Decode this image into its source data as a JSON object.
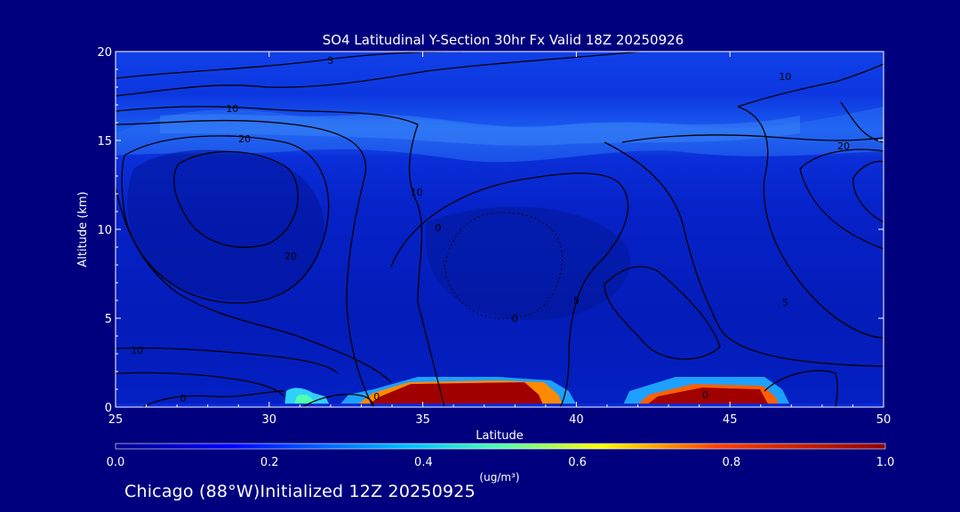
{
  "footer": {
    "location": "Chicago (88°W)",
    "initialized": "Initialized 12Z 20250925"
  },
  "colors": {
    "background": "#00007f",
    "text": "#ffffff",
    "contour": "#000000"
  },
  "chart_data": {
    "type": "heatmap",
    "title": "SO4 Latitudinal Y-Section 30hr  Fx Valid 18Z 20250926",
    "xlabel": "Latitude",
    "ylabel": "Altitude (km)",
    "xlim": [
      25,
      50
    ],
    "ylim": [
      0,
      20
    ],
    "x_ticks": [
      25,
      30,
      35,
      40,
      45,
      50
    ],
    "y_ticks": [
      0,
      5,
      10,
      15,
      20
    ],
    "colorbar": {
      "min": 0.0,
      "max": 1.0,
      "ticks": [
        "0.0",
        "0.2",
        "0.4",
        "0.6",
        "0.8",
        "1.0"
      ],
      "units": "(ug/m³)"
    },
    "concentration_regions": [
      {
        "lat_range": [
          33.5,
          39.5
        ],
        "alt_range": [
          0.0,
          1.4
        ],
        "value": 1.0
      },
      {
        "lat_range": [
          42.0,
          46.5
        ],
        "alt_range": [
          0.0,
          0.9
        ],
        "value": 0.9
      },
      {
        "lat_range": [
          30.5,
          33.0
        ],
        "alt_range": [
          0.0,
          0.8
        ],
        "value": 0.4
      },
      {
        "lat_range": [
          25.0,
          50.0
        ],
        "alt_range": [
          14.0,
          17.5
        ],
        "value": 0.25
      }
    ],
    "contour_labels": [
      {
        "text": "10",
        "lat": 28.8,
        "alt": 16.8
      },
      {
        "text": "20",
        "lat": 29.2,
        "alt": 15.1
      },
      {
        "text": "5",
        "lat": 32.0,
        "alt": 19.5
      },
      {
        "text": "10",
        "lat": 34.8,
        "alt": 12.1
      },
      {
        "text": "20",
        "lat": 30.7,
        "alt": 8.5
      },
      {
        "text": "10",
        "lat": 25.7,
        "alt": 3.2
      },
      {
        "text": "0",
        "lat": 27.2,
        "alt": 0.5
      },
      {
        "text": "0",
        "lat": 33.5,
        "alt": 0.6
      },
      {
        "text": "0",
        "lat": 35.5,
        "alt": 10.1
      },
      {
        "text": "5",
        "lat": 40.0,
        "alt": 6.0
      },
      {
        "text": "0",
        "lat": 38.0,
        "alt": 5.0
      },
      {
        "text": "0",
        "lat": 44.2,
        "alt": 0.7
      },
      {
        "text": "5",
        "lat": 46.8,
        "alt": 5.9
      },
      {
        "text": "10",
        "lat": 46.8,
        "alt": 18.6
      },
      {
        "text": "20",
        "lat": 48.7,
        "alt": 14.7
      }
    ]
  }
}
